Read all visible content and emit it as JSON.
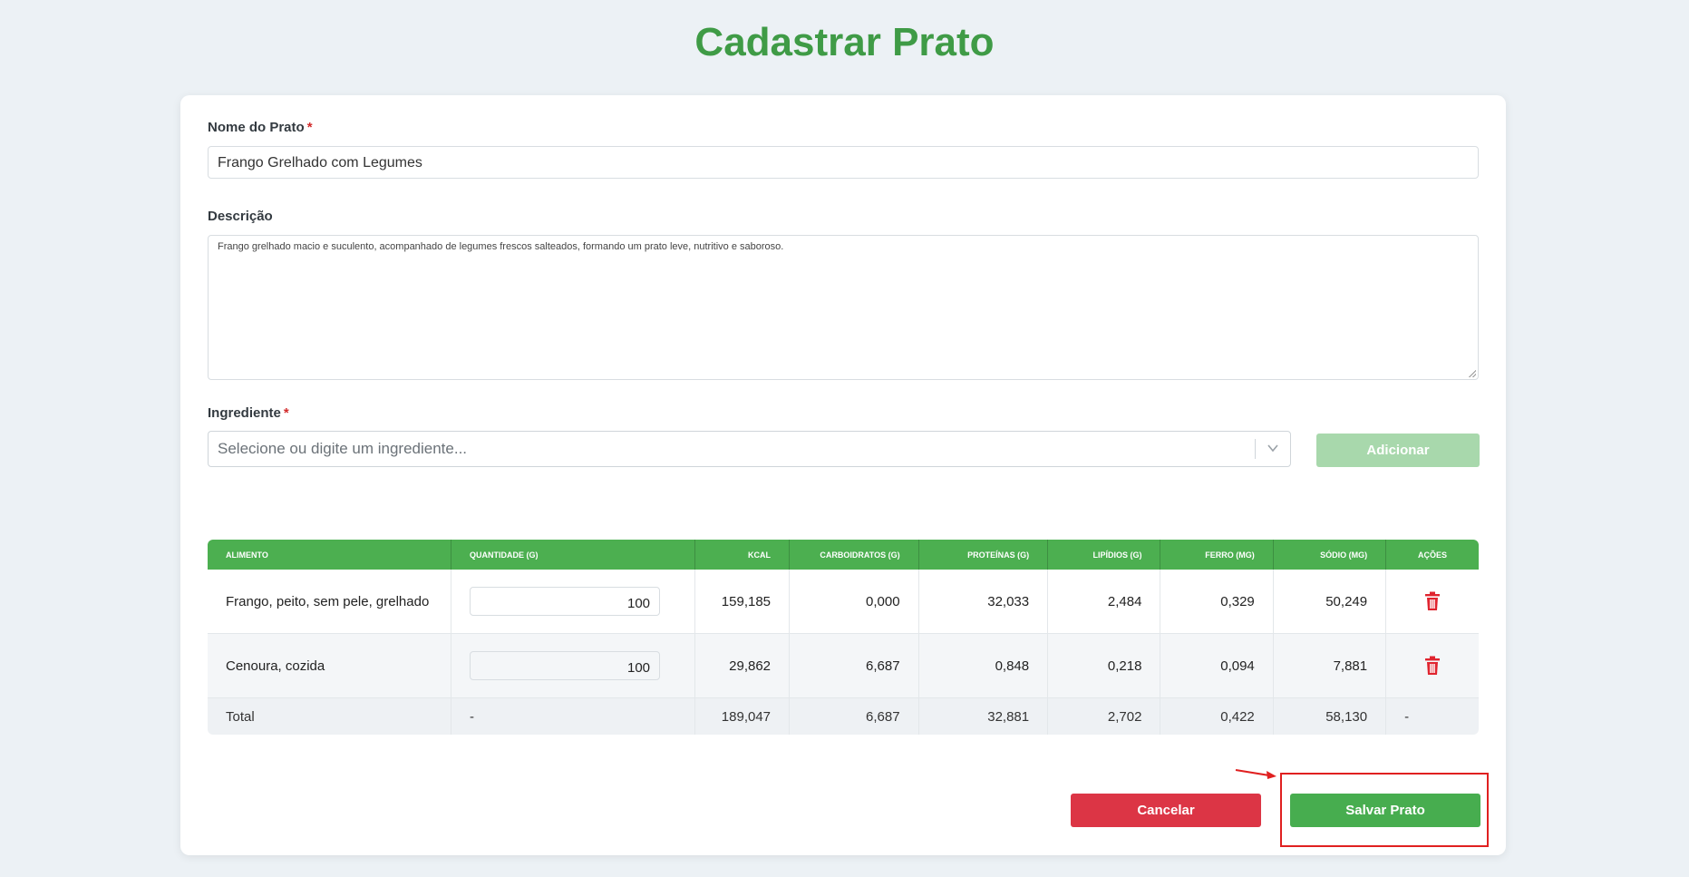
{
  "page": {
    "title": "Cadastrar Prato"
  },
  "form": {
    "name_label": "Nome do Prato",
    "name_required": "*",
    "name_value": "Frango Grelhado com Legumes",
    "description_label": "Descrição",
    "description_value": "Frango grelhado macio e suculento, acompanhado de legumes frescos salteados, formando um prato leve, nutritivo e saboroso.",
    "ingredient_label": "Ingrediente",
    "ingredient_required": "*",
    "ingredient_placeholder": "Selecione ou digite um ingrediente...",
    "add_button": "Adicionar"
  },
  "table": {
    "headers": [
      "Alimento",
      "Quantidade (g)",
      "Kcal",
      "Carboidratos (g)",
      "Proteínas (g)",
      "Lipídios (g)",
      "Ferro (mg)",
      "Sódio (mg)",
      "Ações"
    ],
    "rows": [
      {
        "food": "Frango, peito, sem pele, grelhado",
        "qty": "100",
        "kcal": "159,185",
        "carb": "0,000",
        "prot": "32,033",
        "lip": "2,484",
        "iron": "0,329",
        "sodium": "50,249"
      },
      {
        "food": "Cenoura, cozida",
        "qty": "100",
        "kcal": "29,862",
        "carb": "6,687",
        "prot": "0,848",
        "lip": "0,218",
        "iron": "0,094",
        "sodium": "7,881"
      }
    ],
    "total": {
      "label": "Total",
      "qty": "-",
      "kcal": "189,047",
      "carb": "6,687",
      "prot": "32,881",
      "lip": "2,702",
      "iron": "0,422",
      "sodium": "58,130",
      "actions": "-"
    }
  },
  "actions": {
    "cancel": "Cancelar",
    "save": "Salvar Prato"
  },
  "colors": {
    "brand_green": "#47ad4f",
    "danger_red": "#dc3545",
    "header_green": "#4caf50",
    "annotation_red": "#e02020"
  },
  "icons": {
    "trash": "trash-icon",
    "chevron": "chevron-down-icon",
    "arrow": "annotation-arrow-icon"
  }
}
